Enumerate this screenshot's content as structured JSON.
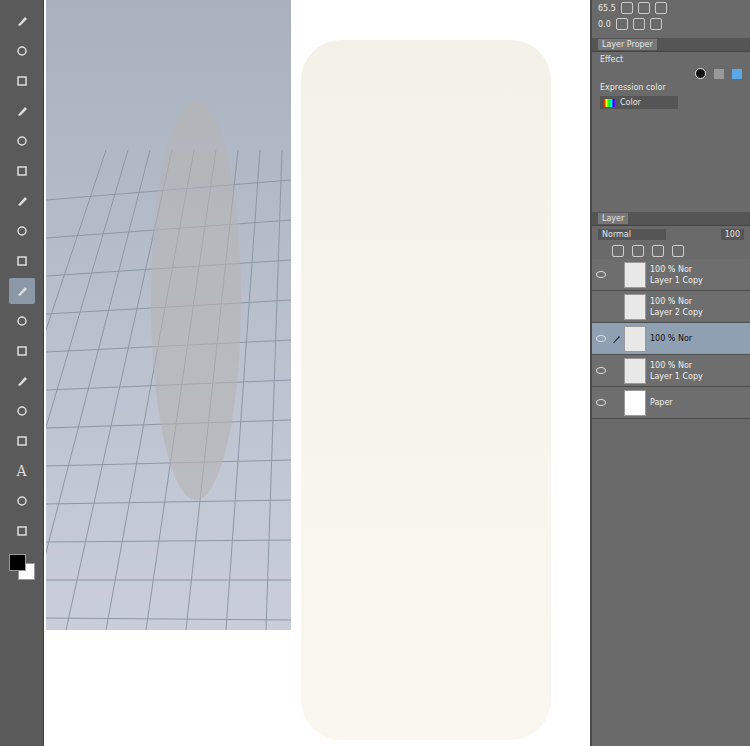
{
  "toolbar": {
    "tools": [
      {
        "selected": false
      },
      {
        "selected": false
      },
      {
        "selected": false
      },
      {
        "selected": false
      },
      {
        "selected": false
      },
      {
        "selected": false
      },
      {
        "selected": false
      },
      {
        "selected": false
      },
      {
        "selected": false
      },
      {
        "selected": true
      },
      {
        "selected": false
      },
      {
        "selected": false
      },
      {
        "selected": false
      },
      {
        "selected": false
      },
      {
        "selected": false
      },
      {
        "selected": false,
        "glyph": "A"
      },
      {
        "selected": false
      },
      {
        "selected": false
      }
    ],
    "main_color": "#000000",
    "sub_color": "#ffffff"
  },
  "top_right": {
    "zoom": "65.5",
    "angle": "0.0"
  },
  "layer_property": {
    "tab": "Layer Proper",
    "effect_label": "Effect",
    "expression_label": "Expression color",
    "expression_value": "Color"
  },
  "layer_panel": {
    "tab": "Layer",
    "blend": "Normal",
    "opacity": "100",
    "layers": [
      {
        "mode": "100 % Nor",
        "name": "Layer 1 Copy",
        "visible": true,
        "selected": false,
        "editing": false,
        "kind": "raster"
      },
      {
        "mode": "100 % Nor",
        "name": "Layer 2 Copy",
        "visible": false,
        "selected": false,
        "editing": false,
        "kind": "raster"
      },
      {
        "mode": "100 % Nor",
        "name": "",
        "visible": true,
        "selected": true,
        "editing": true,
        "kind": "raster"
      },
      {
        "mode": "100 % Nor",
        "name": "Layer 1 Copy",
        "visible": true,
        "selected": false,
        "editing": false,
        "kind": "raster"
      },
      {
        "mode": "",
        "name": "Paper",
        "visible": true,
        "selected": false,
        "editing": false,
        "kind": "paper"
      }
    ]
  }
}
